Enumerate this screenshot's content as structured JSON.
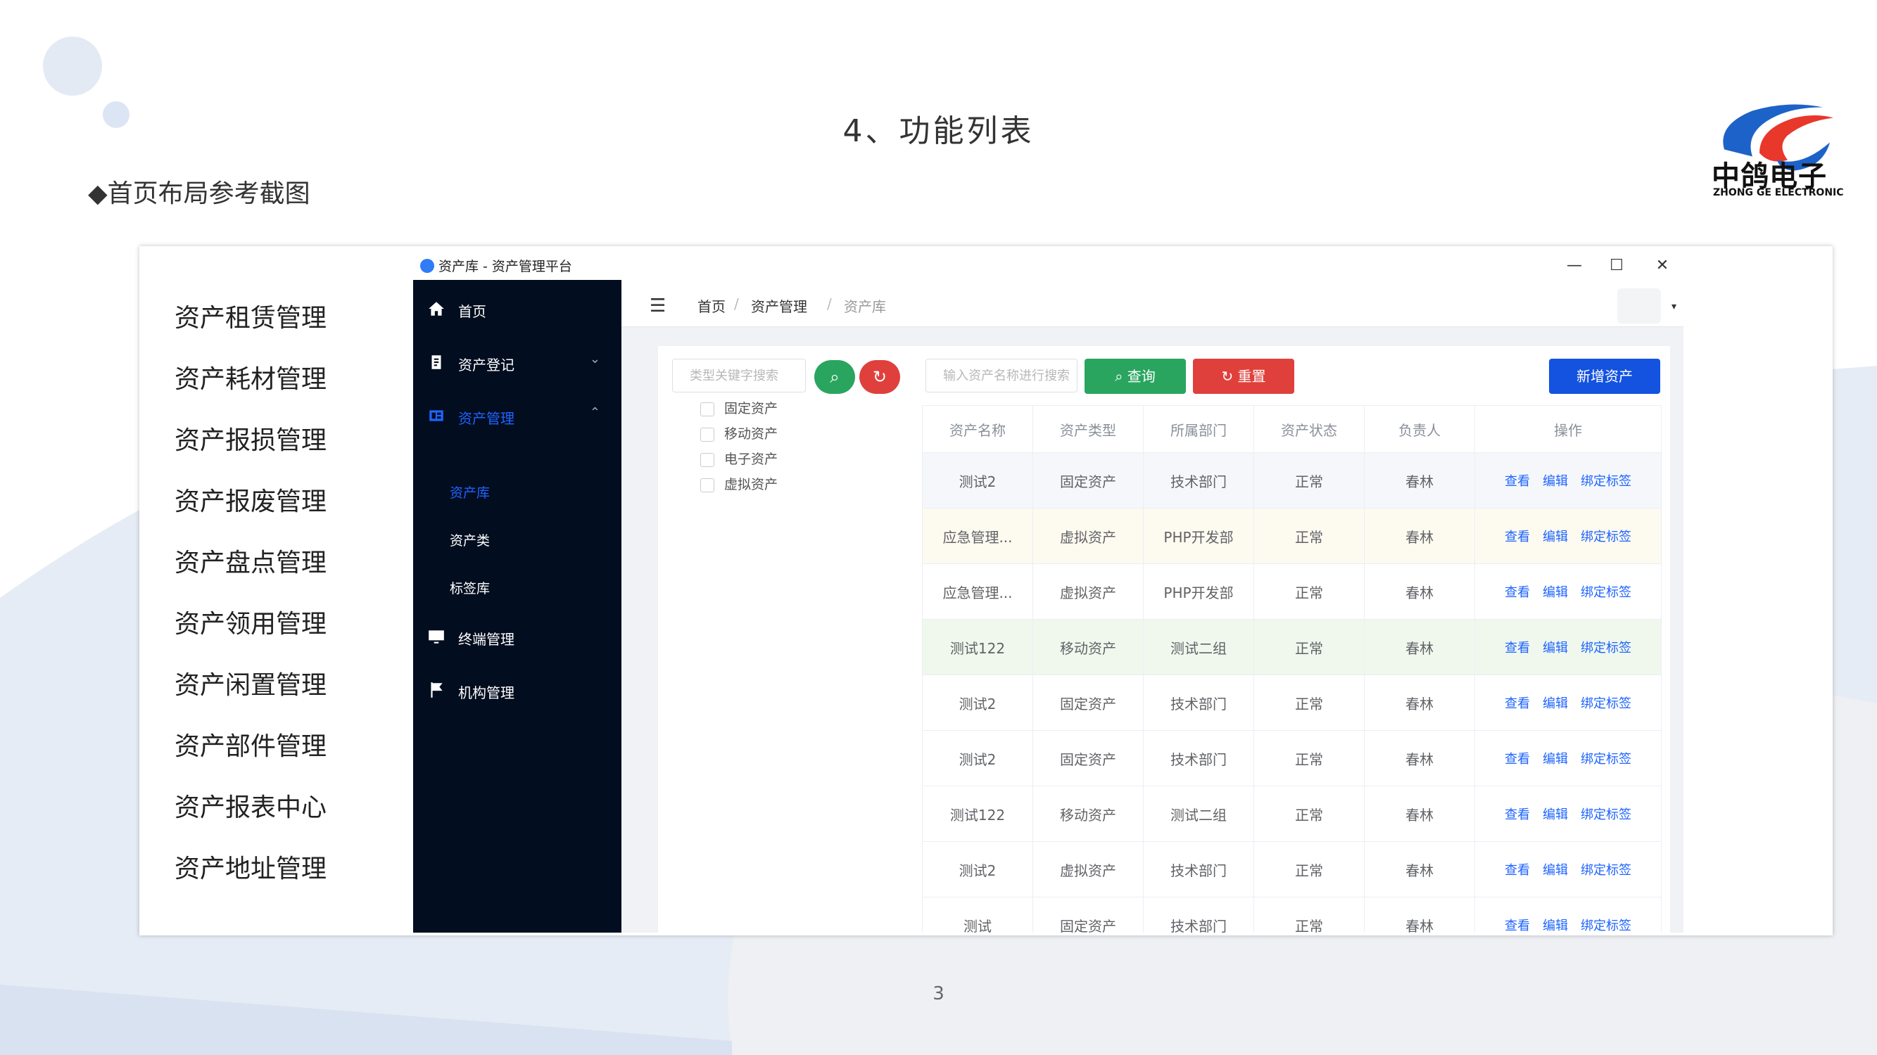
{
  "slide": {
    "title": "4、功能列表",
    "subtitle": "◆首页布局参考截图",
    "page_number": "3",
    "logo_cn": "中鸽电子",
    "logo_en": "ZHONG GE ELECTRONIC"
  },
  "feature_list": [
    "资产租赁管理",
    "资产耗材管理",
    "资产报损管理",
    "资产报废管理",
    "资产盘点管理",
    "资产领用管理",
    "资产闲置管理",
    "资产部件管理",
    "资产报表中心",
    "资产地址管理"
  ],
  "window": {
    "title": "资产库 - 资产管理平台",
    "minimize": "—",
    "maximize": "☐",
    "close": "✕"
  },
  "sidebar": {
    "items": [
      {
        "label": "首页",
        "icon": "home-icon"
      },
      {
        "label": "资产登记",
        "icon": "clipboard-icon"
      },
      {
        "label": "资产管理",
        "icon": "asset-icon"
      },
      {
        "label": "终端管理",
        "icon": "monitor-icon"
      },
      {
        "label": "机构管理",
        "icon": "flag-icon"
      }
    ],
    "sub_items": [
      "资产库",
      "资产类",
      "标签库"
    ],
    "chevron_down": "⌄",
    "chevron_up": "⌃"
  },
  "header": {
    "breadcrumb": [
      "首页",
      "资产管理",
      "资产库"
    ],
    "separator": "/",
    "menu_glyph": "☰",
    "caret": "▾"
  },
  "filter": {
    "type_placeholder": "类型关键字搜索",
    "search_glyph": "⌕",
    "reset_glyph": "↻",
    "tree": [
      "固定资产",
      "移动资产",
      "电子资产",
      "虚拟资产"
    ]
  },
  "toolbar": {
    "name_placeholder": "输入资产名称进行搜索",
    "query_label": "⌕ 查询",
    "reset_label": "↻ 重置",
    "add_label": "新增资产"
  },
  "table": {
    "columns": [
      "资产名称",
      "资产类型",
      "所属部门",
      "资产状态",
      "负责人",
      "操作"
    ],
    "actions": [
      "查看",
      "编辑",
      "绑定标签"
    ],
    "rows": [
      [
        "测试2",
        "固定资产",
        "技术部门",
        "正常",
        "春林"
      ],
      [
        "应急管理...",
        "虚拟资产",
        "PHP开发部",
        "正常",
        "春林"
      ],
      [
        "应急管理...",
        "虚拟资产",
        "PHP开发部",
        "正常",
        "春林"
      ],
      [
        "测试122",
        "移动资产",
        "测试二组",
        "正常",
        "春林"
      ],
      [
        "测试2",
        "固定资产",
        "技术部门",
        "正常",
        "春林"
      ],
      [
        "测试2",
        "固定资产",
        "技术部门",
        "正常",
        "春林"
      ],
      [
        "测试122",
        "移动资产",
        "测试二组",
        "正常",
        "春林"
      ],
      [
        "测试2",
        "虚拟资产",
        "技术部门",
        "正常",
        "春林"
      ],
      [
        "测试",
        "固定资产",
        "技术部门",
        "正常",
        "春林"
      ]
    ]
  },
  "colors": {
    "sidebar_bg": "#020d1f",
    "accent": "#1e64ff",
    "query_green": "#2aa55f",
    "reset_red": "#e0403c",
    "add_blue": "#1453e0"
  }
}
